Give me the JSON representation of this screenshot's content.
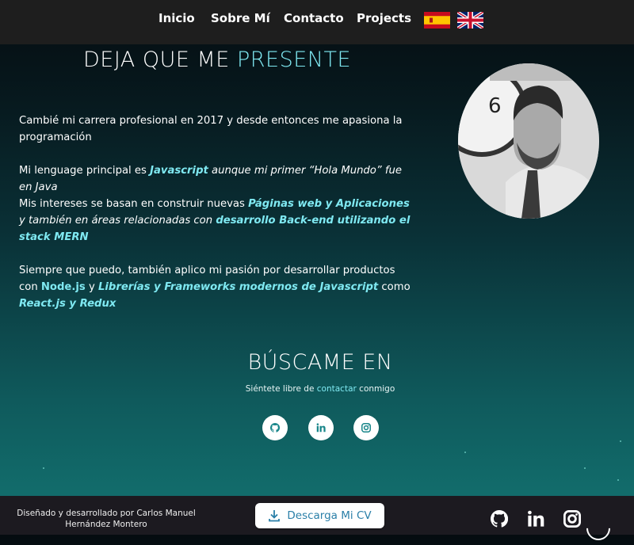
{
  "nav": {
    "items": [
      "Inicio",
      "Sobre Mí",
      "Contacto",
      "Projects"
    ],
    "flags": [
      "spanish-flag-icon",
      "uk-flag-icon"
    ]
  },
  "about": {
    "title_main": "DEJA QUE ME ",
    "title_accent": "PRESENTE",
    "p1": "Cambié mi carrera profesional en 2017 y desde entonces me apasiona la programación",
    "p2_a": "Mi lenguage principal es ",
    "p2_hl": "Javascript",
    "p2_b": " aunque mi primer  “Hola Mundo” fue en Java",
    "p3_a": "Mis intereses se basan en construir nuevas ",
    "p3_hl1": "Páginas web y Aplicaciones",
    "p3_b": " y también en áreas relacionadas con ",
    "p3_hl2": "desarrollo Back-end utilizando el stack MERN",
    "p4_a": "Siempre que puedo, también aplico mi pasión por desarrollar productos con ",
    "p4_hl1": "Node.js",
    "p4_b": " y ",
    "p4_hl2": "Librerías y Frameworks modernos de Javascript",
    "p4_c": "  como ",
    "p4_hl3": "React.js y Redux"
  },
  "contact": {
    "title": "BÚSCAME EN",
    "sub_a": "Siéntete libre de ",
    "sub_link": "contactar",
    "sub_b": " conmigo",
    "icons": [
      "github-icon",
      "linkedin-icon",
      "instagram-icon"
    ]
  },
  "footer": {
    "credit": "Diseñado y desarrollado por Carlos Manuel Hernández Montero",
    "cv_button": "Descarga Mi CV",
    "icons": [
      "github-icon",
      "linkedin-icon",
      "instagram-icon"
    ]
  },
  "colors": {
    "accent": "#7fe9f2",
    "nav_bg": "#1e1e1e",
    "footer_bg": "#1c1a20",
    "cv_text": "#2a7fa8"
  }
}
